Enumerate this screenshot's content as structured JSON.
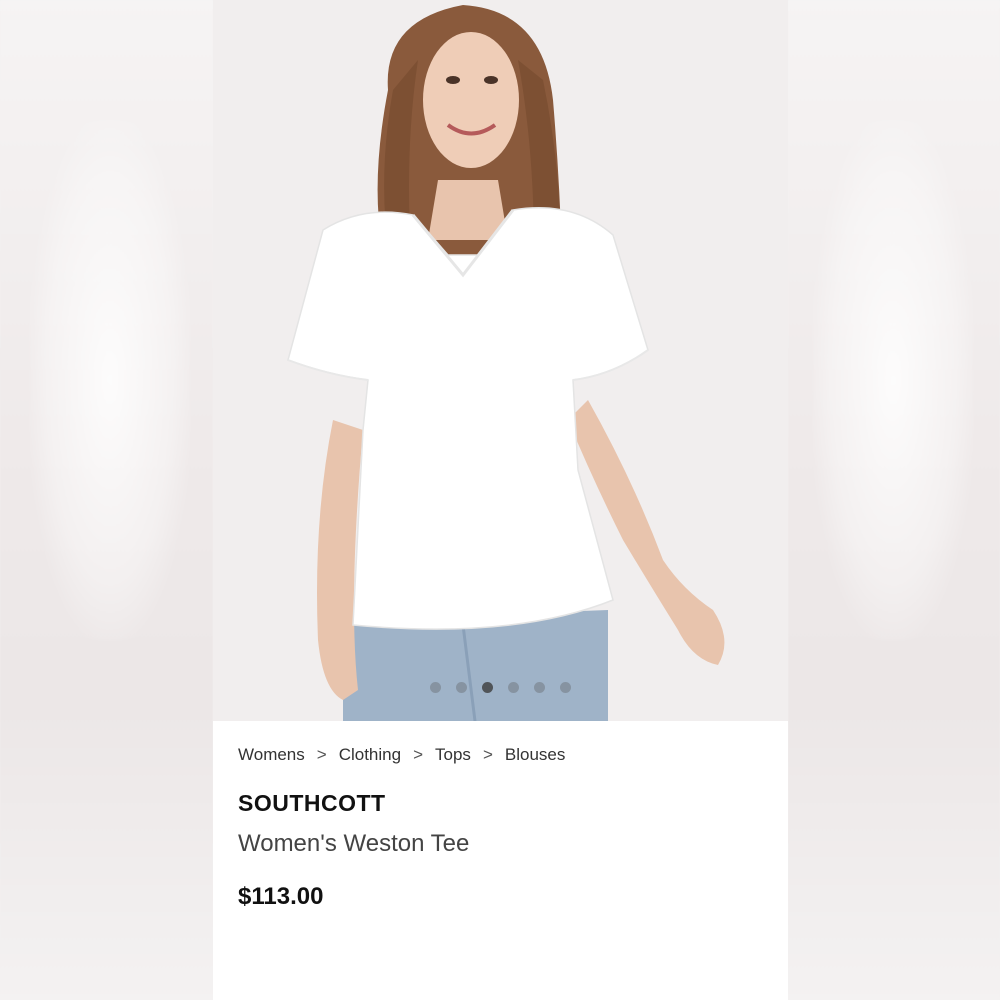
{
  "breadcrumb": {
    "items": [
      "Womens",
      "Clothing",
      "Tops",
      "Blouses"
    ],
    "separator": ">"
  },
  "product": {
    "brand": "SOUTHCOTT",
    "title": "Women's Weston Tee",
    "price": "$113.00"
  },
  "carousel": {
    "image_count": 6,
    "active_index": 2
  },
  "colors": {
    "card_background": "#ffffff",
    "image_background": "#f1eeee",
    "brand_text": "#111111",
    "title_text": "#444444"
  }
}
